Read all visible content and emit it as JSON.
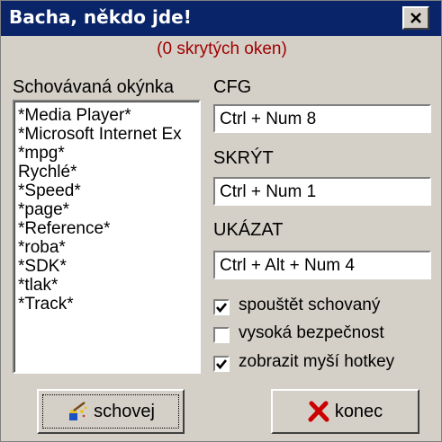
{
  "window": {
    "title": "Bacha, někdo jde!"
  },
  "status": {
    "hidden_count_text": "(0 skrytých oken)"
  },
  "hidden_windows": {
    "label": "Schovávaná okýnka",
    "items": [
      "*Media Player*",
      "*Microsoft Internet Ex",
      "*mpg*",
      "Rychlé*",
      "*Speed*",
      "*page*",
      "*Reference*",
      "*roba*",
      "*SDK*",
      "*tlak*",
      "*Track*"
    ]
  },
  "cfg": {
    "label": "CFG",
    "value": "Ctrl + Num 8"
  },
  "hide": {
    "label": "SKRÝT",
    "value": "Ctrl + Num 1"
  },
  "show": {
    "label": "UKÁZAT",
    "value": "Ctrl + Alt + Num 4"
  },
  "options": [
    {
      "label": "spouštět schovaný",
      "checked": true
    },
    {
      "label": "vysoká bezpečnost",
      "checked": false
    },
    {
      "label": "zobrazit myší hotkey",
      "checked": true
    }
  ],
  "buttons": {
    "hide_label": "schovej",
    "exit_label": "konec"
  },
  "icons": {
    "close": "close-icon",
    "hide": "broom-icon",
    "exit": "red-x-icon"
  },
  "colors": {
    "titlebar": "#0a246a",
    "face": "#d4d0c8",
    "status_text": "#a00000",
    "exit_icon": "#cc0000"
  }
}
